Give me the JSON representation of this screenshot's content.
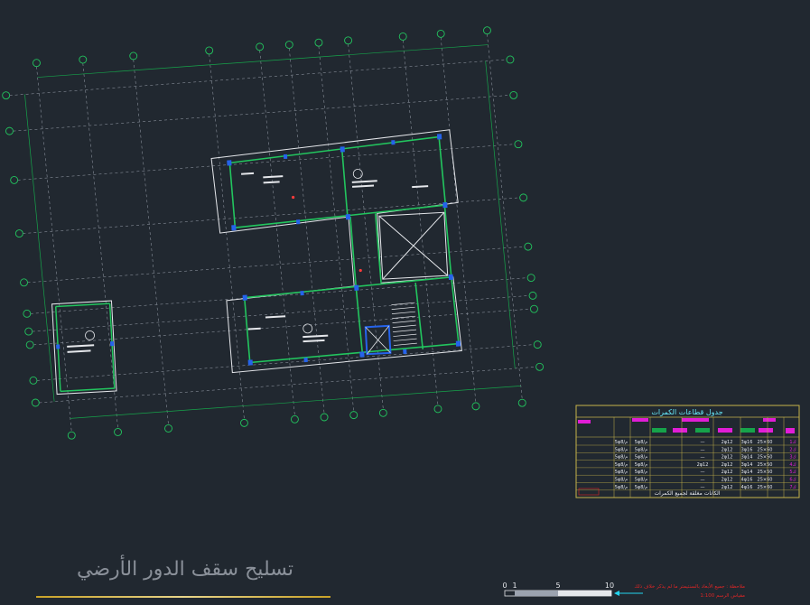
{
  "sheet": {
    "title": "تسليح سقف الدور الأرضي",
    "note_line1": "ملاحظة : جميع الأبعاد بالسنتيمتر ما لم يذكر خلاف ذلك",
    "note_line2": "مقياس الرسم 1:100",
    "scale_labels": [
      "0",
      "1",
      "5",
      "10"
    ]
  },
  "colors": {
    "background": "#212830",
    "grid": "#b8bcc2",
    "beam": "#22c55e",
    "wall": "#e5e7eb",
    "column": "#2563eb",
    "dimension": "#16a34a",
    "magenta": "#e11dd6",
    "table_border": "#c7b34a",
    "title_underline": "#d9c26a",
    "note_text": "#dc2626"
  },
  "plan_labels": {
    "room_note": "تسليح بلاطة",
    "stair_label": "بئر السلم"
  },
  "schedule": {
    "title": "جدول قطاعات الكمرات",
    "header_groups": [
      "التسليح السفلي",
      "التسليح العلوي",
      "الكانات",
      "الأبعاد"
    ],
    "header_cells": [
      "رقم الكمرة",
      "القطاع",
      "حديد سفلي",
      "حديد علوي",
      "حديد إضافي",
      "كانات"
    ],
    "rows": [
      [
        "ك1",
        "25×60",
        "3φ16",
        "2φ12",
        "—",
        "5φ8/م"
      ],
      [
        "ك2",
        "25×60",
        "3φ16",
        "2φ12",
        "—",
        "5φ8/م"
      ],
      [
        "ك3",
        "25×50",
        "3φ14",
        "2φ12",
        "—",
        "5φ8/م"
      ],
      [
        "ك4",
        "25×50",
        "3φ14",
        "2φ12",
        "2φ12",
        "5φ8/م"
      ],
      [
        "ك5",
        "25×50",
        "3φ14",
        "2φ12",
        "—",
        "5φ8/م"
      ],
      [
        "ك6",
        "25×60",
        "4φ16",
        "2φ12",
        "—",
        "5φ8/م"
      ],
      [
        "ك7",
        "25×60",
        "4φ16",
        "2φ12",
        "—",
        "5φ8/م"
      ]
    ],
    "footer": "الكانات مغلقة لجميع الكمرات"
  }
}
